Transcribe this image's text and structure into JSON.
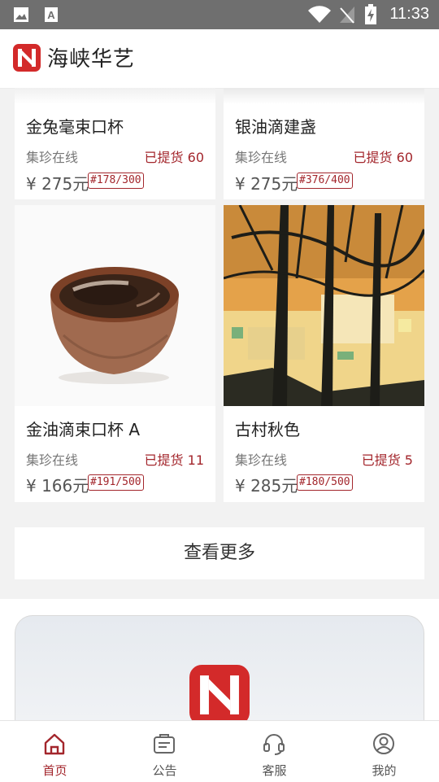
{
  "status": {
    "time": "11:33"
  },
  "app": {
    "title": "海峡华艺"
  },
  "products": [
    {
      "name": "金兔毫束口杯",
      "shop": "集珍在线",
      "picked": "已提货 60",
      "price": "¥ 275元",
      "edition": "#178/300"
    },
    {
      "name": "银油滴建盏",
      "shop": "集珍在线",
      "picked": "已提货 60",
      "price": "¥ 275元",
      "edition": "#376/400"
    },
    {
      "name": "金油滴束口杯 A",
      "shop": "集珍在线",
      "picked": "已提货 11",
      "price": "¥ 166元",
      "edition": "#191/500"
    },
    {
      "name": "古村秋色",
      "shop": "集珍在线",
      "picked": "已提货 5",
      "price": "¥ 285元",
      "edition": "#180/500"
    }
  ],
  "more_button": "查看更多",
  "tabs": [
    {
      "label": "首页",
      "icon": "home-icon",
      "active": true
    },
    {
      "label": "公告",
      "icon": "notice-icon",
      "active": false
    },
    {
      "label": "客服",
      "icon": "headset-icon",
      "active": false
    },
    {
      "label": "我的",
      "icon": "user-icon",
      "active": false
    }
  ],
  "colors": {
    "accent": "#a3262c",
    "statusbar": "#6f6f6f",
    "brand_red": "#d32a2a"
  }
}
